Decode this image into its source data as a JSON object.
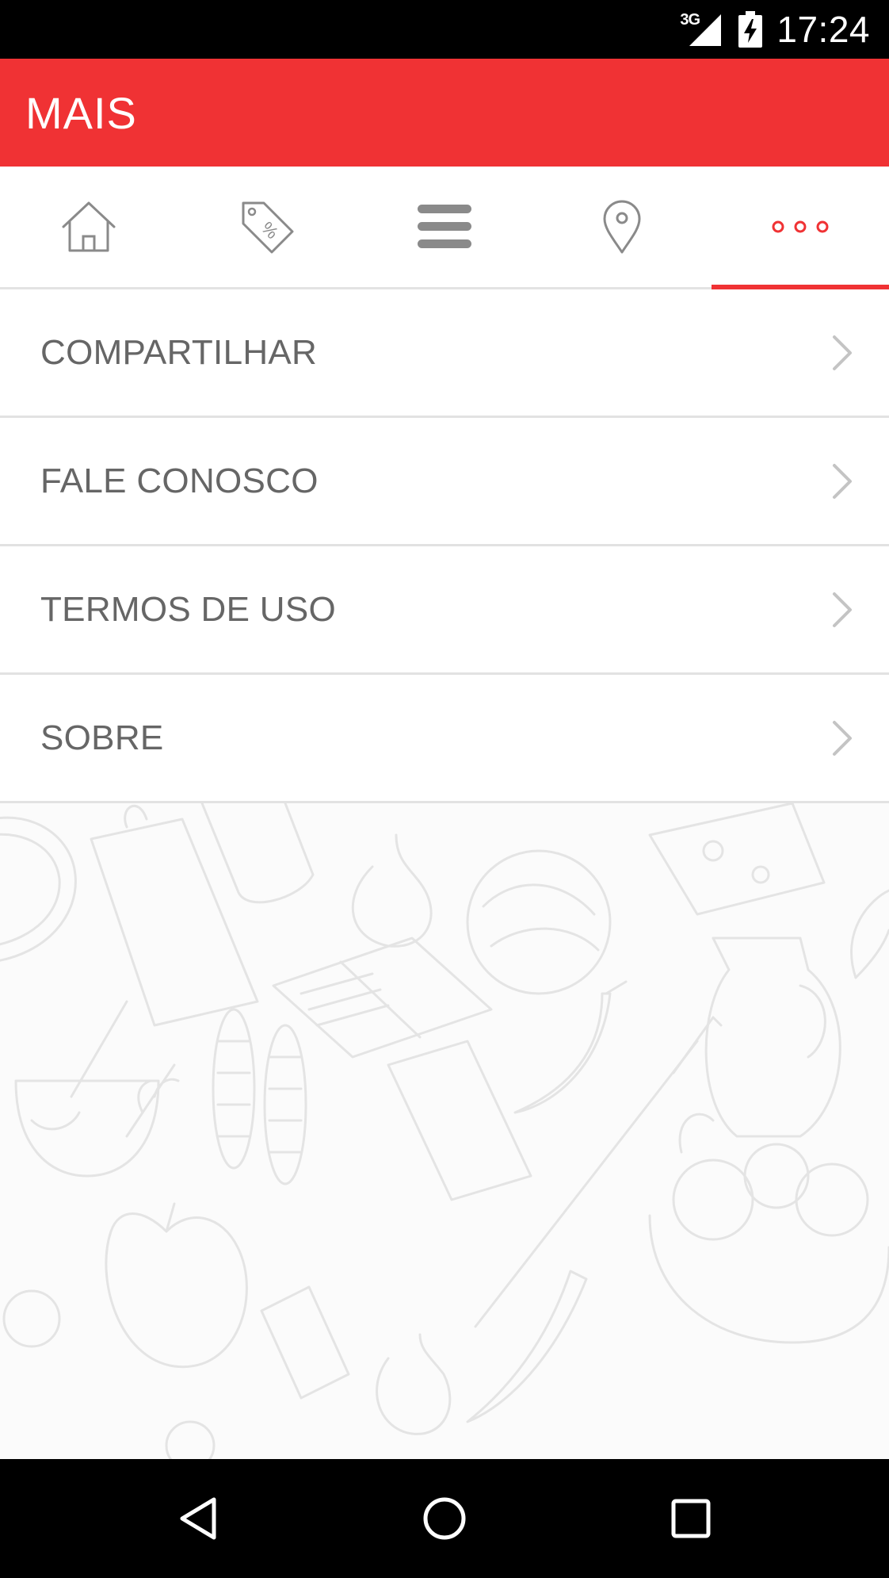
{
  "status_bar": {
    "network": "3G",
    "time": "17:24"
  },
  "app_bar": {
    "title": "MAIS",
    "color": "#f03234"
  },
  "tabs": [
    {
      "icon": "home-icon",
      "active": false
    },
    {
      "icon": "price-tag-percent-icon",
      "active": false
    },
    {
      "icon": "menu-icon",
      "active": false
    },
    {
      "icon": "location-pin-icon",
      "active": false
    },
    {
      "icon": "more-dots-icon",
      "active": true
    }
  ],
  "menu": {
    "items": [
      {
        "label": "COMPARTILHAR"
      },
      {
        "label": "FALE CONOSCO"
      },
      {
        "label": "TERMOS DE USO"
      },
      {
        "label": "SOBRE"
      }
    ]
  },
  "nav_bar": {
    "buttons": [
      "back-icon",
      "home-circle-icon",
      "recents-square-icon"
    ]
  }
}
